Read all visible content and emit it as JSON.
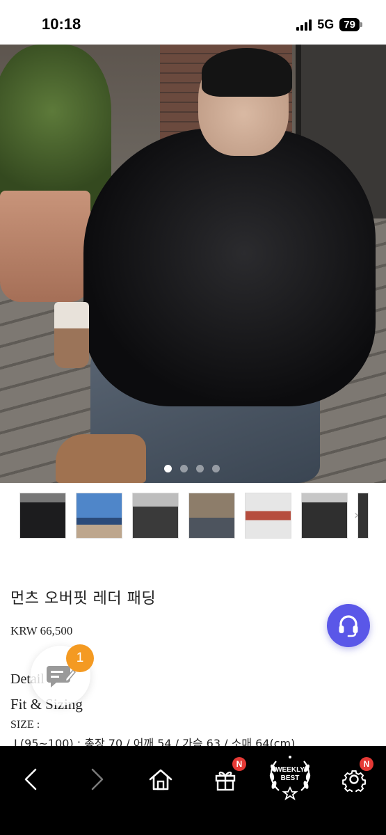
{
  "status_bar": {
    "time": "10:18",
    "network": "5G",
    "battery": "79"
  },
  "gallery": {
    "dots": [
      true,
      false,
      false,
      false
    ],
    "thumbnails": [
      "thumb-1",
      "thumb-2",
      "thumb-3",
      "thumb-4",
      "thumb-5",
      "thumb-6",
      "thumb-7"
    ]
  },
  "product": {
    "title": "먼츠 오버핏 레더 패딩",
    "price": "KRW 66,500",
    "detail_heading": "Detail",
    "fit_heading": "Fit & Sizing",
    "size_label": "SIZE :",
    "size_line": "L(95~100) : 총장 70 / 어깨 54 / 가슴 63 / 소매 64(cm)"
  },
  "chat": {
    "badge_count": "1"
  },
  "bottom_nav": {
    "gift_badge": "N",
    "weekly_best_line1": "WEEKLY",
    "weekly_best_line2": "BEST",
    "settings_badge": "N"
  },
  "colors": {
    "support_fab": "#5a57e8",
    "chat_badge": "#f49a22",
    "nav_badge": "#e53935",
    "nav_background": "#000000"
  }
}
